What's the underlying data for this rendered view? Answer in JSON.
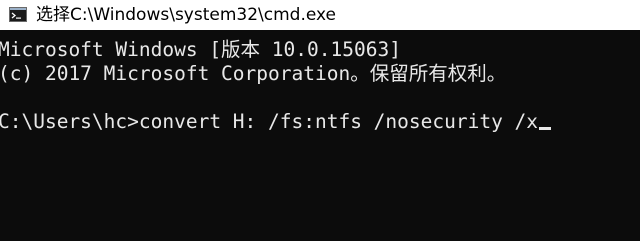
{
  "window": {
    "title": "选择C:\\Windows\\system32\\cmd.exe",
    "icon": "cmd-console-icon"
  },
  "console": {
    "lines": [
      "Microsoft Windows [版本 10.0.15063]",
      "(c) 2017 Microsoft Corporation。保留所有权利。",
      "",
      "C:\\Users\\hc>convert H: /fs:ntfs /nosecurity /x"
    ],
    "cursor": "block-underline"
  },
  "colors": {
    "console_background": "#0c0c0c",
    "console_text": "#e8e8e8",
    "titlebar_background": "#ffffff"
  }
}
